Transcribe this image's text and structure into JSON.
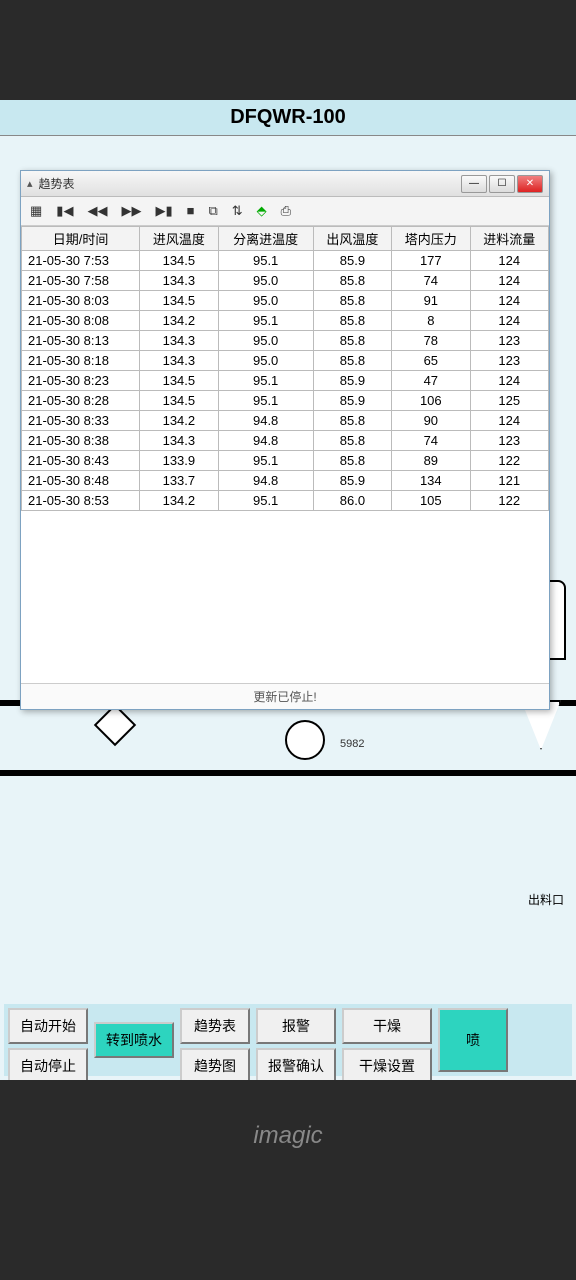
{
  "app": {
    "title": "DFQWR-100"
  },
  "popup": {
    "title": "趋势表",
    "status": "更新已停止!",
    "columns": [
      "日期/时间",
      "进风温度",
      "分离进温度",
      "出风温度",
      "塔内压力",
      "进料流量"
    ],
    "rows": [
      [
        "21-05-30 7:53",
        "134.5",
        "95.1",
        "85.9",
        "177",
        "124"
      ],
      [
        "21-05-30 7:58",
        "134.3",
        "95.0",
        "85.8",
        "74",
        "124"
      ],
      [
        "21-05-30 8:03",
        "134.5",
        "95.0",
        "85.8",
        "91",
        "124"
      ],
      [
        "21-05-30 8:08",
        "134.2",
        "95.1",
        "85.8",
        "8",
        "124"
      ],
      [
        "21-05-30 8:13",
        "134.3",
        "95.0",
        "85.8",
        "78",
        "123"
      ],
      [
        "21-05-30 8:18",
        "134.3",
        "95.0",
        "85.8",
        "65",
        "123"
      ],
      [
        "21-05-30 8:23",
        "134.5",
        "95.1",
        "85.9",
        "47",
        "124"
      ],
      [
        "21-05-30 8:28",
        "134.5",
        "95.1",
        "85.9",
        "106",
        "125"
      ],
      [
        "21-05-30 8:33",
        "134.2",
        "94.8",
        "85.8",
        "90",
        "124"
      ],
      [
        "21-05-30 8:38",
        "134.3",
        "94.8",
        "85.8",
        "74",
        "123"
      ],
      [
        "21-05-30 8:43",
        "133.9",
        "95.1",
        "85.8",
        "89",
        "122"
      ],
      [
        "21-05-30 8:48",
        "133.7",
        "94.8",
        "85.9",
        "134",
        "121"
      ],
      [
        "21-05-30 8:53",
        "134.2",
        "95.1",
        "86.0",
        "105",
        "122"
      ]
    ]
  },
  "diagram": {
    "tag1": "5982",
    "outlet_label": "出料口"
  },
  "buttons": {
    "auto_start": "自动开始",
    "auto_stop": "自动停止",
    "switch_spray": "转到喷水",
    "trend_table": "趋势表",
    "trend_chart": "趋势图",
    "alarm": "报警",
    "alarm_ack": "报警确认",
    "dry": "干燥",
    "dry_settings": "干燥设置",
    "spray": "喷"
  },
  "monitor_brand": "imagic"
}
